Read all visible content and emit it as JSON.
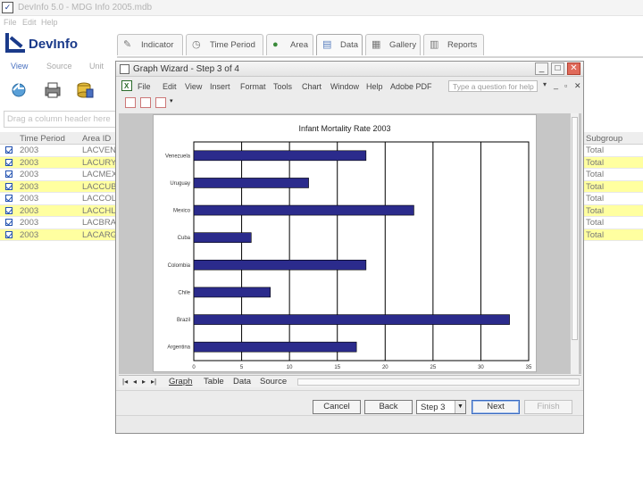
{
  "app": {
    "title": "DevInfo 5.0 - MDG Info 2005.mdb",
    "logo_text": "DevInfo"
  },
  "menu": [
    "File",
    "Edit",
    "Help"
  ],
  "tabs": [
    {
      "label": "Indicator",
      "icon": "pencil-icon"
    },
    {
      "label": "Time Period",
      "icon": "clock-icon"
    },
    {
      "label": "Area",
      "icon": "globe-icon"
    },
    {
      "label": "Data",
      "icon": "folder-icon"
    },
    {
      "label": "Gallery",
      "icon": "gallery-icon"
    },
    {
      "label": "Reports",
      "icon": "reports-icon"
    }
  ],
  "subnav": [
    "View",
    "Source",
    "Unit"
  ],
  "grouping_placeholder": "Drag a column header here",
  "grid": {
    "headers": [
      "Time Period",
      "Area ID"
    ],
    "rows": [
      {
        "time": "2003",
        "area": "LACVEN"
      },
      {
        "time": "2003",
        "area": "LACURY"
      },
      {
        "time": "2003",
        "area": "LACMEX"
      },
      {
        "time": "2003",
        "area": "LACCUB"
      },
      {
        "time": "2003",
        "area": "LACCOL"
      },
      {
        "time": "2003",
        "area": "LACCHL"
      },
      {
        "time": "2003",
        "area": "LACBRA"
      },
      {
        "time": "2003",
        "area": "LACARG"
      }
    ],
    "subgroup_header": "Subgroup",
    "subgroup_values": [
      "Total",
      "Total",
      "Total",
      "Total",
      "Total",
      "Total",
      "Total",
      "Total"
    ]
  },
  "wizard": {
    "title": "Graph Wizard - Step 3 of 4",
    "menu": [
      "File",
      "Edit",
      "View",
      "Insert",
      "Format",
      "Tools",
      "Chart",
      "Window",
      "Help",
      "Adobe PDF"
    ],
    "help_placeholder": "Type a question for help",
    "sheet_tabs": [
      "Graph",
      "Table",
      "Data",
      "Source"
    ],
    "buttons": {
      "cancel": "Cancel",
      "back": "Back",
      "step": "Step 3",
      "next": "Next",
      "finish": "Finish"
    }
  },
  "chart_data": {
    "type": "bar",
    "orientation": "horizontal",
    "title": "Infant Mortality Rate   2003",
    "categories": [
      "Venezuela",
      "Uruguay",
      "Mexico",
      "Cuba",
      "Colombia",
      "Chile",
      "Brazil",
      "Argentina"
    ],
    "values": [
      18,
      12,
      23,
      6,
      18,
      8,
      33,
      17
    ],
    "xlim": [
      0,
      35
    ],
    "xticks": [
      "0",
      "5",
      "10",
      "15",
      "20",
      "25",
      "30",
      "35"
    ],
    "gridlines": true,
    "bar_color": "#2b2b8c"
  }
}
